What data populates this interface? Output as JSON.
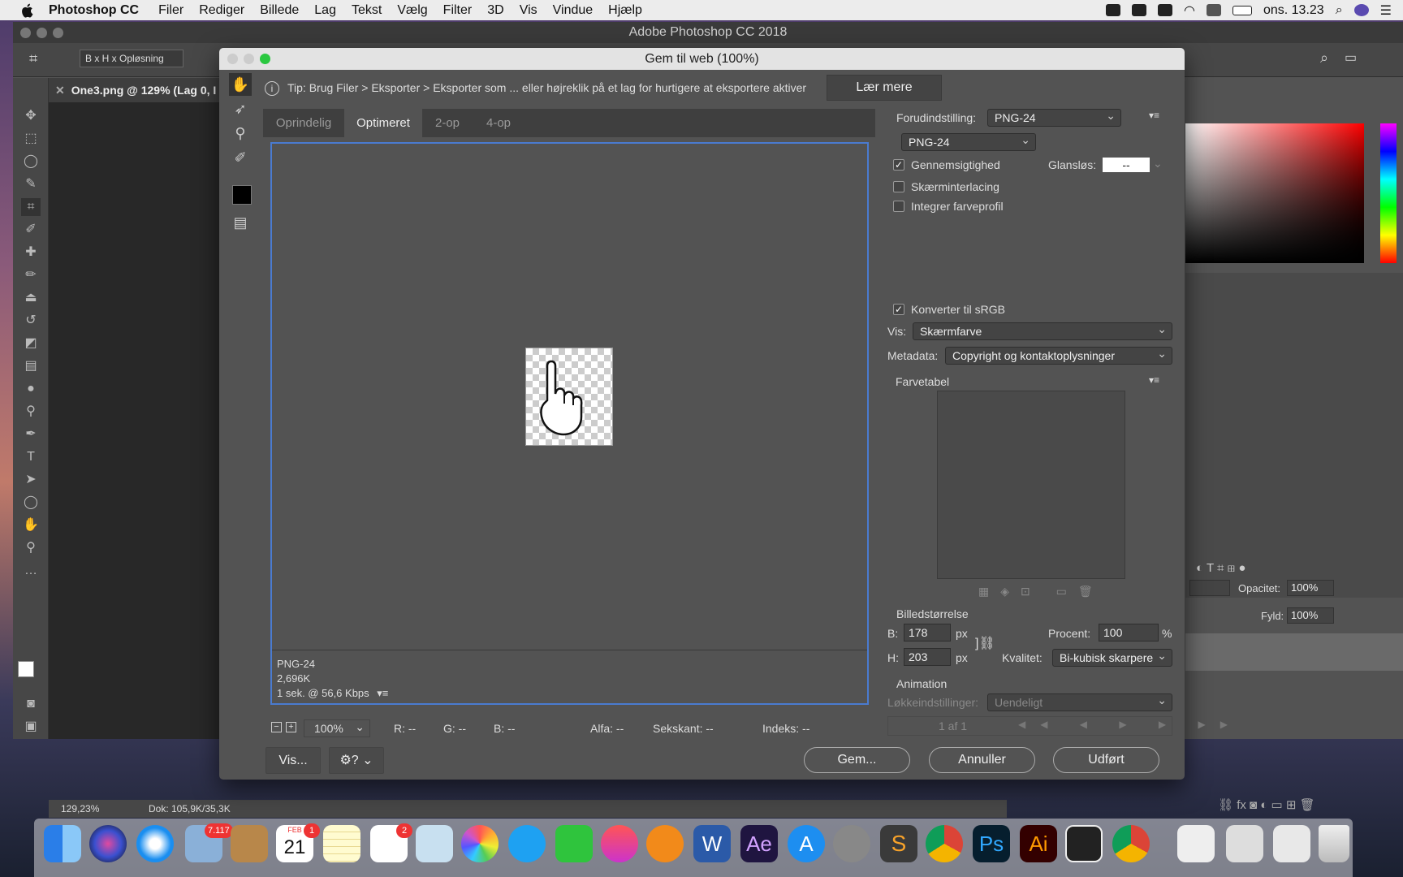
{
  "menubar": {
    "app": "Photoshop CC",
    "items": [
      "Filer",
      "Rediger",
      "Billede",
      "Lag",
      "Tekst",
      "Vælg",
      "Filter",
      "3D",
      "Vis",
      "Vindue",
      "Hjælp"
    ],
    "clock": "ons. 13.23"
  },
  "ps": {
    "window_title": "Adobe Photoshop CC 2018",
    "option_select": "B x H x Opløsning",
    "doc_tab": "One3.png @ 129% (Lag 0, I",
    "status_zoom": "129,23%",
    "status_doc": "Dok: 105,9K/35,3K",
    "opacity_label": "Opacitet:",
    "opacity_value": "100%",
    "fill_label": "Fyld:",
    "fill_value": "100%"
  },
  "dialog": {
    "title": "Gem til web (100%)",
    "tip": "Tip: Brug Filer > Eksporter > Eksporter som ... eller højreklik på et lag for hurtigere at eksportere aktiver",
    "learn_more": "Lær mere",
    "tabs": [
      "Oprindelig",
      "Optimeret",
      "2-op",
      "4-op"
    ],
    "preview_info": {
      "format": "PNG-24",
      "size": "2,696K",
      "time": "1 sek. @ 56,6 Kbps"
    },
    "zoom": "100%",
    "readouts": {
      "r": "R: --",
      "g": "G: --",
      "b": "B: --",
      "alpha": "Alfa: --",
      "hex": "Sekskant: --",
      "index": "Indeks: --"
    },
    "preview_btn": "Vis...",
    "save_btn": "Gem...",
    "cancel_btn": "Annuller",
    "done_btn": "Udført",
    "settings": {
      "preset_label": "Forudindstilling:",
      "preset_value": "PNG-24",
      "format_value": "PNG-24",
      "transparency": "Gennemsigtighed",
      "matte_label": "Glansløs:",
      "matte_value": "--",
      "interlace": "Skærminterlacing",
      "embed_profile": "Integrer farveprofil",
      "convert_srgb": "Konverter til sRGB",
      "preview_label": "Vis:",
      "preview_value": "Skærmfarve",
      "metadata_label": "Metadata:",
      "metadata_value": "Copyright og kontaktoplysninger",
      "color_table": "Farvetabel",
      "image_size": "Billedstørrelse",
      "w_label": "B:",
      "w_value": "178",
      "h_label": "H:",
      "h_value": "203",
      "px": "px",
      "percent_label": "Procent:",
      "percent_value": "100",
      "percent_sign": "%",
      "quality_label": "Kvalitet:",
      "quality_value": "Bi-kubisk skarpere",
      "animation": "Animation",
      "loop_label": "Løkkeindstillinger:",
      "loop_value": "Uendeligt",
      "frame": "1 af 1"
    }
  },
  "dock": {
    "mail_badge": "7.117",
    "calendar_badge": "1",
    "calendar_month": "FEB",
    "calendar_day": "21",
    "reminders_badge": "2",
    "ps_label": "Ps",
    "ai_label": "Ai",
    "ae_label": "Ae"
  }
}
